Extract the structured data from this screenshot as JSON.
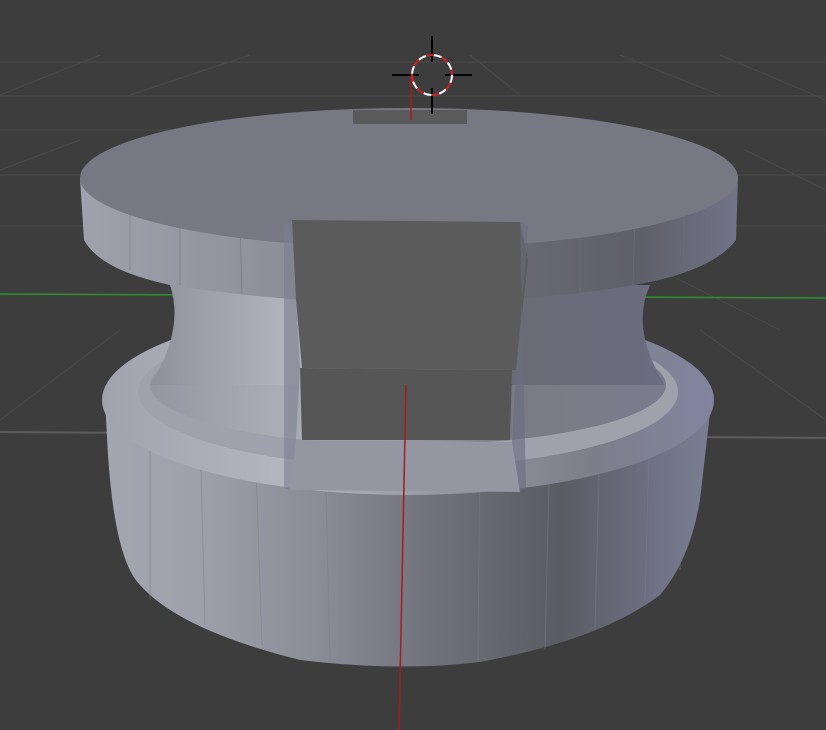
{
  "viewport": {
    "background": "#3d3d3d",
    "grid_color": "#474747",
    "x_axis_color": "#2a8a2a",
    "y_axis_color": "#8a1e1e",
    "horizon_color": "#5a5a5a"
  },
  "cursor": {
    "name": "3d-cursor",
    "ring_colors": [
      "#ffffff",
      "#cc2222"
    ],
    "crosshair_color": "#000000"
  },
  "object": {
    "name": "spool-mesh",
    "base_color": "#8f909c",
    "cap_color": "#787884",
    "slot_color": "#5a5a5a"
  }
}
